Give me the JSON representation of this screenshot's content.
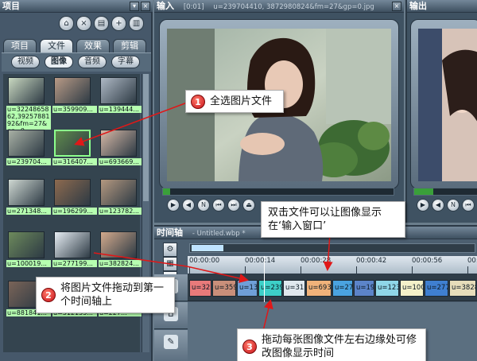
{
  "project_panel": {
    "title": "项目",
    "tabs": [
      {
        "label": "项目"
      },
      {
        "label": "文件"
      },
      {
        "label": "效果"
      },
      {
        "label": "剪辑"
      }
    ],
    "active_tab": "文件",
    "filter_tabs": [
      {
        "label": "视频"
      },
      {
        "label": "图像"
      },
      {
        "label": "音频"
      },
      {
        "label": "字幕"
      }
    ],
    "active_filter": "图像",
    "files": [
      {
        "caption": "u=3224865862,3925788192&fm=27&gp=0",
        "thumb": "#c9d8c0"
      },
      {
        "caption": "u=359909...",
        "thumb": "#b89a86"
      },
      {
        "caption": "u=139444...",
        "thumb": "#aeb8c4"
      },
      {
        "caption": "u=239704...",
        "thumb": "#a8b0a4"
      },
      {
        "caption": "u=316407...",
        "thumb": "#5f8a4d"
      },
      {
        "caption": "u=693669...",
        "thumb": "#d6b8a6"
      },
      {
        "caption": "u=271348...",
        "thumb": "#cfd8d2"
      },
      {
        "caption": "u=196299...",
        "thumb": "#8d6a4f"
      },
      {
        "caption": "u=123782...",
        "thumb": "#b49880"
      },
      {
        "caption": "u=100019...",
        "thumb": "#6d8a5c"
      },
      {
        "caption": "u=277199...",
        "thumb": "#e7eef4"
      },
      {
        "caption": "u=382824...",
        "thumb": "#d2a98c"
      },
      {
        "caption": "u=881841...",
        "thumb": "#7a6458"
      },
      {
        "caption": "u=312155...",
        "thumb": "#4a5a48"
      },
      {
        "caption": "u=227...",
        "thumb": "#8a9aa4"
      }
    ]
  },
  "input_panel": {
    "title": "输入",
    "timecode": "[0:01]",
    "filename": "u=239704410, 3872980824&fm=27&gp=0.jpg"
  },
  "output_panel": {
    "title": "输出"
  },
  "timeline": {
    "title": "时间轴",
    "project_file": "- Untitled.wbp *",
    "ruler_ticks": [
      "00:00:00",
      "00:00:14",
      "00:00:28",
      "00:00:42",
      "00:00:56",
      "00:01:10"
    ],
    "clips": [
      {
        "label": "u=322",
        "color": "#e87a7a"
      },
      {
        "label": "u=3599",
        "color": "#c98f7a"
      },
      {
        "label": "u=139",
        "color": "#6f9fd8"
      },
      {
        "label": "u=239",
        "color": "#3dd0c8"
      },
      {
        "label": "u=316",
        "color": "#e0e8ee"
      },
      {
        "label": "u=6938",
        "color": "#f0b27a"
      },
      {
        "label": "u=27",
        "color": "#4aa3e0"
      },
      {
        "label": "u=196",
        "color": "#5c84c9"
      },
      {
        "label": "u=123",
        "color": "#8fd6e8"
      },
      {
        "label": "u=1000",
        "color": "#f4f1c9"
      },
      {
        "label": "u=277",
        "color": "#3f7fd0"
      },
      {
        "label": "u=38282",
        "color": "#e6ddba"
      }
    ]
  },
  "callouts": [
    {
      "num": "1",
      "text": "全选图片文件"
    },
    {
      "num": "",
      "text": "双击文件可以让图像显示在‘输入窗口’"
    },
    {
      "num": "2",
      "text": "将图片文件拖动到第一个时间轴上"
    },
    {
      "num": "3",
      "text": "拖动每张图像文件左右边缘处可修改图像显示时间"
    }
  ],
  "colors": {
    "callout_arrow": "#e01818",
    "selection_outline": "#8cff8c",
    "caption_bg": "#b6ffb0"
  }
}
